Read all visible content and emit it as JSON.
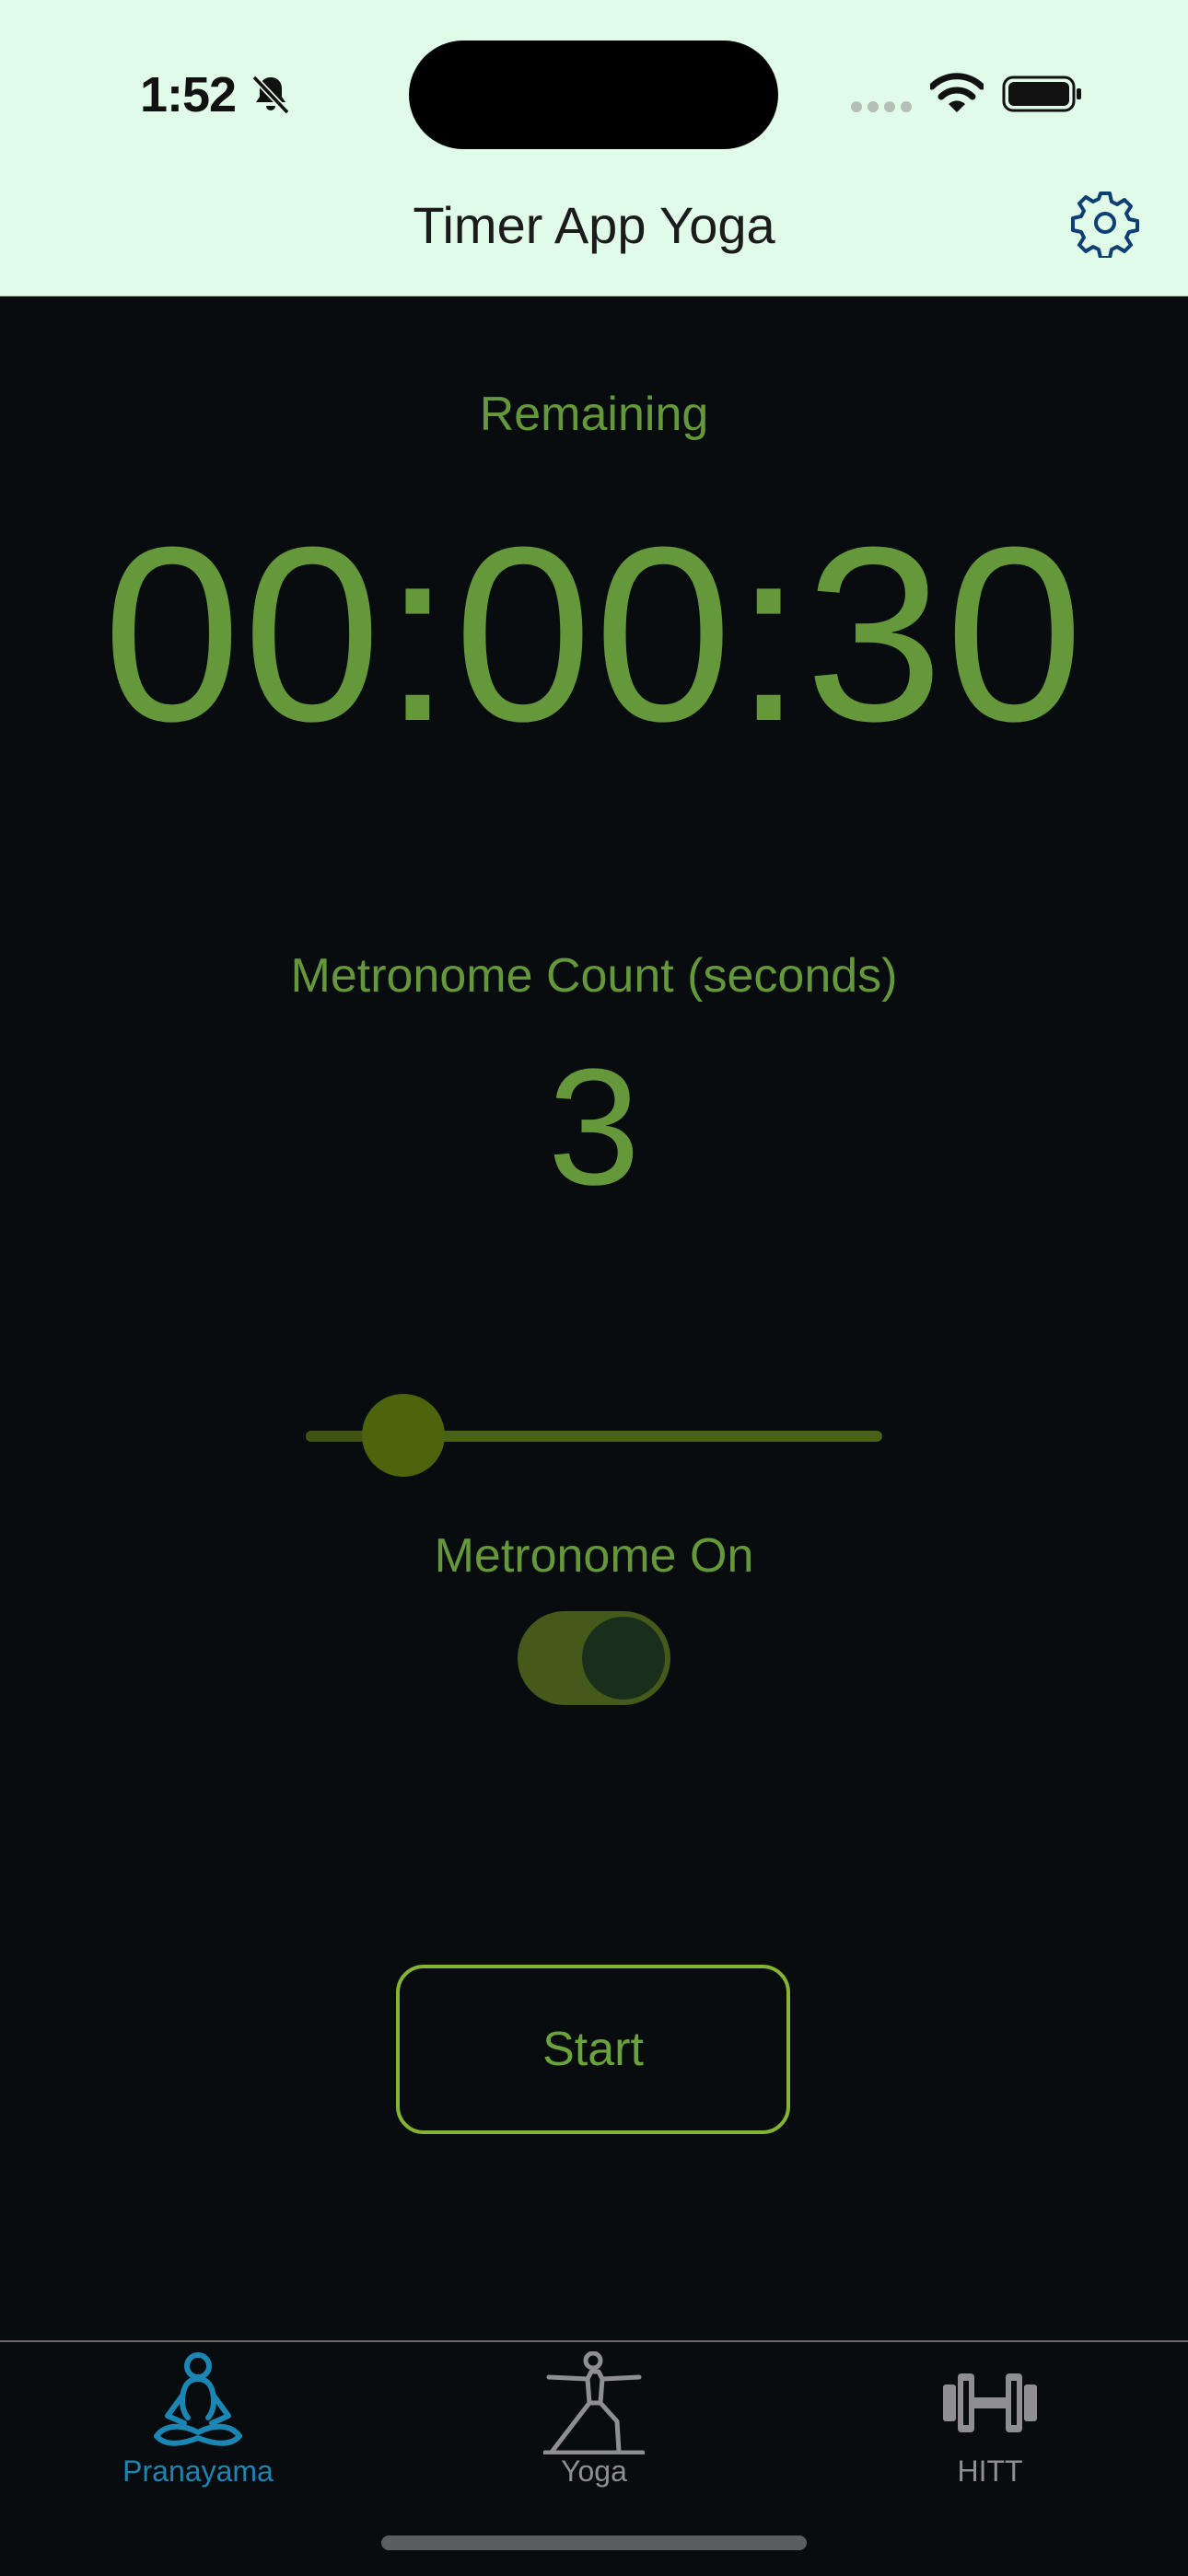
{
  "status_bar": {
    "time": "1:52",
    "icons": [
      "bell-slash-icon",
      "signal-icon",
      "wifi-icon",
      "battery-icon"
    ]
  },
  "header": {
    "title": "Timer App Yoga",
    "settings_icon": "gear-icon"
  },
  "timer": {
    "label": "Remaining",
    "value": "00:00:30"
  },
  "metronome": {
    "label": "Metronome Count (seconds)",
    "value": "3",
    "slider_fraction": 0.17,
    "toggle_label": "Metronome On",
    "toggle_on": true
  },
  "actions": {
    "start_label": "Start"
  },
  "tabs": [
    {
      "label": "Pranayama",
      "icon": "meditation-figure-icon",
      "selected": true
    },
    {
      "label": "Yoga",
      "icon": "yoga-pose-icon",
      "selected": false
    },
    {
      "label": "HITT",
      "icon": "dumbbell-icon",
      "selected": false
    }
  ],
  "colors": {
    "header_bg": "#e1fbe9",
    "background": "#080c0e",
    "accent_green": "#64983a",
    "tab_selected": "#1b86b3",
    "tab_unselected": "#8e8e93"
  }
}
